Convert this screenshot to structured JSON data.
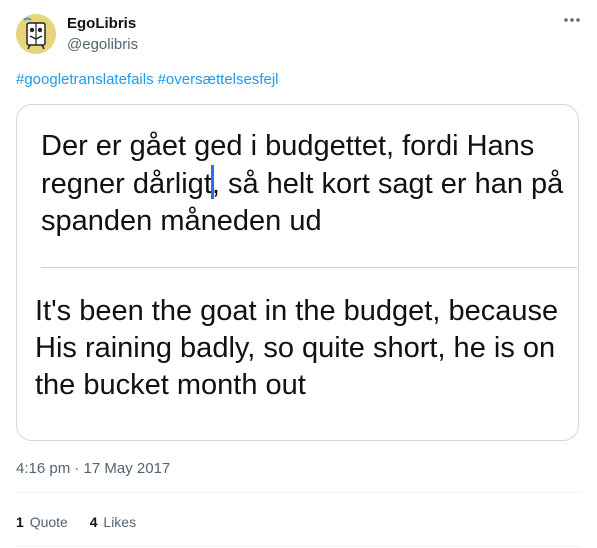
{
  "tweet": {
    "author_name": "EgoLibris",
    "author_handle": "@egolibris",
    "hashtags": [
      "#googletranslatefails",
      "#oversættelsesfejl"
    ],
    "timestamp": "4:16 pm · 17 May 2017",
    "more_icon": "more-horizontal-icon",
    "avatar_icon": "egolibris-book-mascot"
  },
  "image": {
    "danish_before_cursor": "Der er gået ged i budgettet, fordi Hans regner dårligt",
    "danish_after_cursor": ", så helt kort sagt er han på spanden måneden ud",
    "english_text": "It's been the goat in the budget, because His raining badly, so quite short, he is on the bucket month out"
  },
  "stats": {
    "quotes_count": "1",
    "quotes_label": "Quote",
    "likes_count": "4",
    "likes_label": "Likes"
  },
  "colors": {
    "link": "#1d9bf0",
    "muted": "#536471",
    "cursor": "#2a6ef5"
  }
}
